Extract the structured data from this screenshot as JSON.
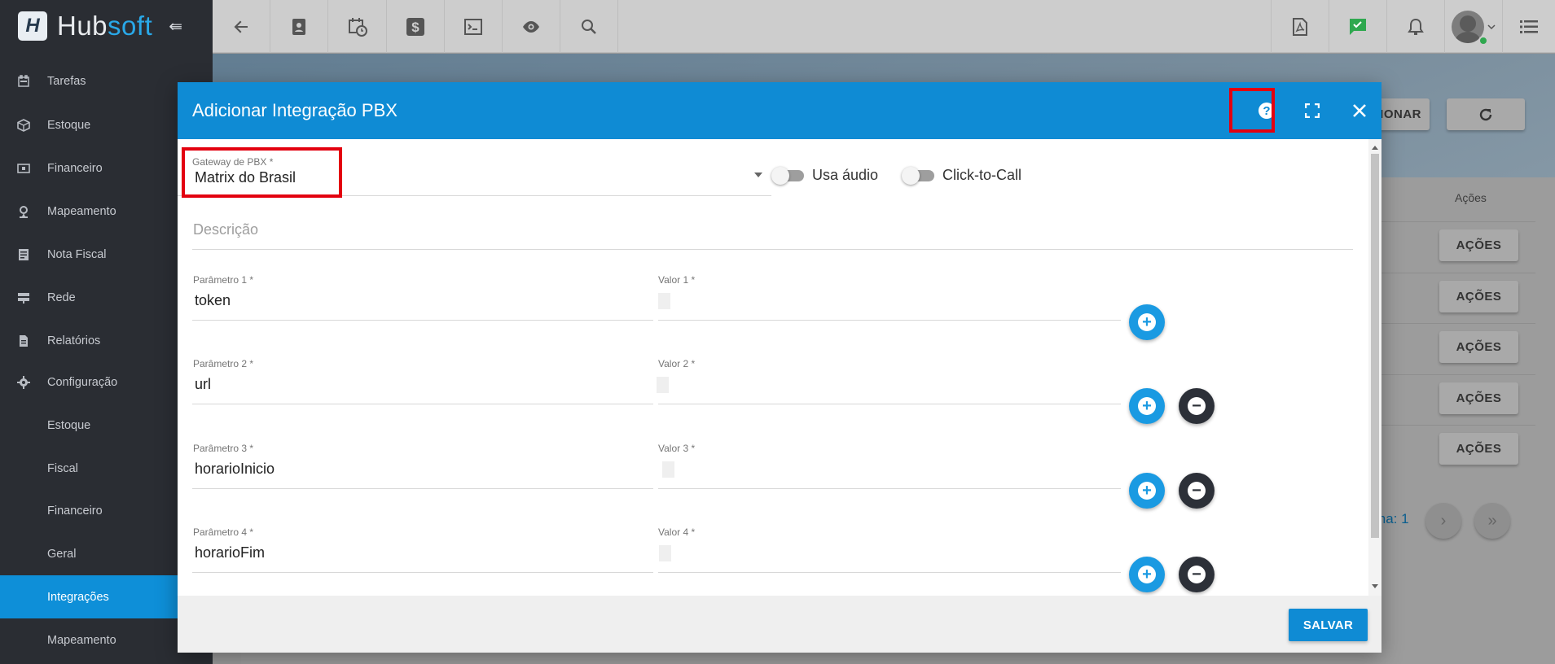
{
  "brand": {
    "name_part1": "Hub",
    "name_part2": "soft"
  },
  "sidebar": {
    "items": [
      {
        "label": "Tarefas",
        "icon": "calendar-icon"
      },
      {
        "label": "Estoque",
        "icon": "box-icon"
      },
      {
        "label": "Financeiro",
        "icon": "money-icon"
      },
      {
        "label": "Mapeamento",
        "icon": "map-pin-icon"
      },
      {
        "label": "Nota Fiscal",
        "icon": "document-icon"
      },
      {
        "label": "Rede",
        "icon": "server-icon"
      },
      {
        "label": "Relatórios",
        "icon": "report-icon"
      },
      {
        "label": "Configuração",
        "icon": "gear-icon"
      }
    ],
    "sub_items": [
      {
        "label": "Estoque"
      },
      {
        "label": "Fiscal"
      },
      {
        "label": "Financeiro"
      },
      {
        "label": "Geral"
      },
      {
        "label": "Integrações",
        "active": true
      },
      {
        "label": "Mapeamento"
      }
    ]
  },
  "topbar": {
    "icons": [
      "back-arrow-icon",
      "contact-card-icon",
      "calendar-clock-icon",
      "dollar-icon",
      "terminal-icon",
      "eye-icon",
      "search-icon",
      "pdf-icon",
      "chat-check-icon",
      "bell-icon",
      "avatar",
      "menu-icon"
    ]
  },
  "background_page": {
    "adicionar_partial": "CIONAR",
    "acoes_header": "Ações",
    "acoes_button": "AÇÕES",
    "page_partial": "ina: 1"
  },
  "modal": {
    "title": "Adicionar Integração PBX",
    "gateway": {
      "label": "Gateway de PBX *",
      "value": "Matrix do Brasil"
    },
    "toggles": [
      {
        "label": "Usa áudio",
        "on": false
      },
      {
        "label": "Click-to-Call",
        "on": false
      }
    ],
    "descricao_placeholder": "Descrição",
    "params": [
      {
        "param_label": "Parâmetro 1 *",
        "param_value": "token",
        "valor_label": "Valor 1 *"
      },
      {
        "param_label": "Parâmetro 2 *",
        "param_value": "url",
        "valor_label": "Valor 2 *"
      },
      {
        "param_label": "Parâmetro 3 *",
        "param_value": "horarioInicio",
        "valor_label": "Valor 3 *"
      },
      {
        "param_label": "Parâmetro 4 *",
        "param_value": "horarioFim",
        "valor_label": "Valor 4 *"
      }
    ],
    "save_label": "SALVAR"
  },
  "colors": {
    "primary": "#0f8bd4",
    "sidebar": "#2a2d33",
    "highlight": "#e3000f"
  }
}
